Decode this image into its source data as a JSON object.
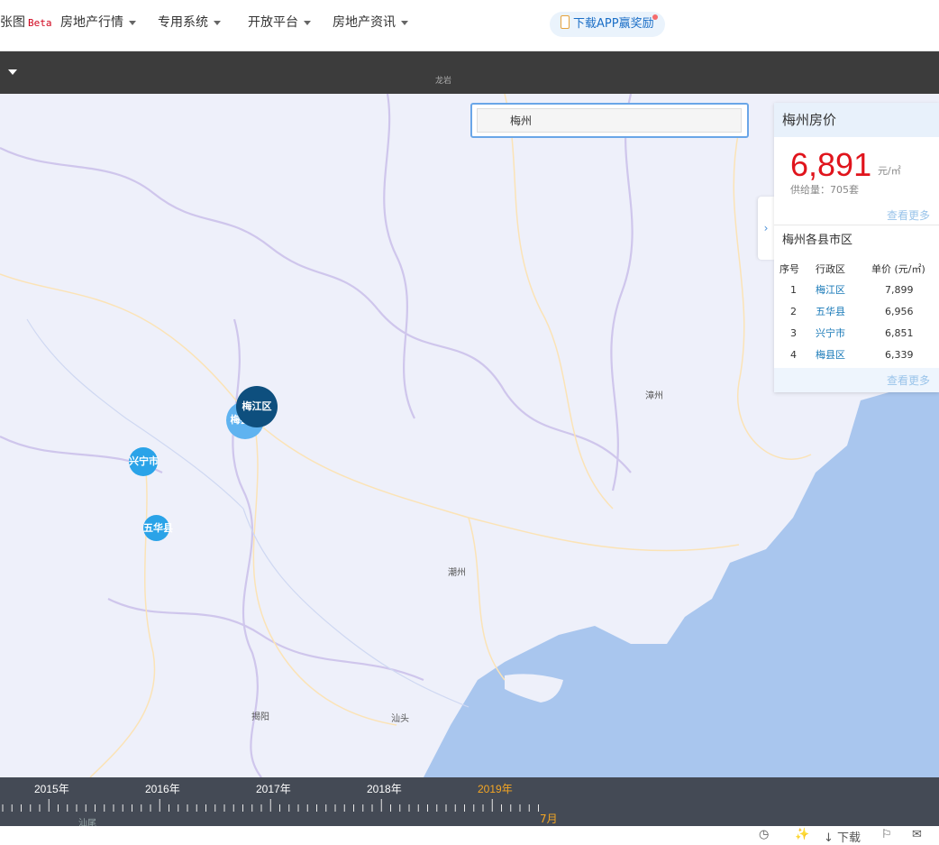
{
  "nav": {
    "brand": "张图",
    "beta": "Beta",
    "items": [
      "房地产行情",
      "专用系统",
      "开放平台",
      "房地产资讯"
    ],
    "app_download": "下载APP赢奖励"
  },
  "darkbar": {
    "map_label": "龙岩"
  },
  "search": {
    "value": "梅州"
  },
  "map": {
    "labels": [
      "漳州",
      "潮州",
      "揭阳",
      "汕头",
      "汕尾"
    ],
    "bubbles": [
      {
        "label": "梅江区",
        "color": "#0e4f7e"
      },
      {
        "label": "梅县区",
        "color": "#5fb3f0"
      },
      {
        "label": "兴宁市",
        "color": "#2aa3e8"
      },
      {
        "label": "五华县",
        "color": "#2aa3e8"
      }
    ]
  },
  "panel": {
    "title": "梅州房价",
    "price": "6,891",
    "unit": "元/㎡",
    "supply": "供给量：705套",
    "more": "查看更多",
    "subtitle": "梅州各县市区",
    "columns": [
      "序号",
      "行政区",
      "单价 (元/㎡)"
    ],
    "rows": [
      {
        "no": "1",
        "district": "梅江区",
        "price": "7,899"
      },
      {
        "no": "2",
        "district": "五华县",
        "price": "6,956"
      },
      {
        "no": "3",
        "district": "兴宁市",
        "price": "6,851"
      },
      {
        "no": "4",
        "district": "梅县区",
        "price": "6,339"
      }
    ],
    "more2": "查看更多"
  },
  "timeline": {
    "years": [
      "2015年",
      "2016年",
      "2017年",
      "2018年",
      "2019年"
    ],
    "active_year": "2019年",
    "month": "7月"
  },
  "tools": {
    "download": "下载"
  },
  "colors": {
    "accent": "#1879b8",
    "price": "#e0141c",
    "timeline_active": "#f5a623"
  }
}
